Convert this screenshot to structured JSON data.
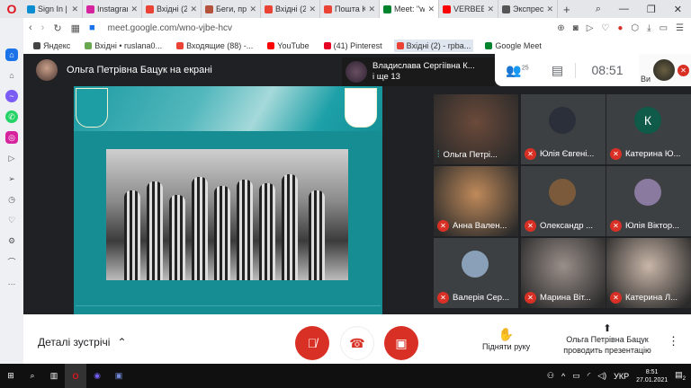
{
  "browser": {
    "tabs": [
      {
        "label": "Sign In |",
        "color": "#0b8ed1"
      },
      {
        "label": "Instagram",
        "color": "#d6249f"
      },
      {
        "label": "Вхідні (2",
        "color": "#ea4335"
      },
      {
        "label": "Беги, пр",
        "color": "#b5523b"
      },
      {
        "label": "Вхідні (2",
        "color": "#ea4335"
      },
      {
        "label": "Пошта К",
        "color": "#ea4335"
      },
      {
        "label": "Meet: \"w",
        "color": "#00832d"
      },
      {
        "label": "VERBEE",
        "color": "#ff0000"
      },
      {
        "label": "Экспрес",
        "color": "#555555"
      }
    ],
    "new_tab": "+",
    "url": "meet.google.com/wno-vjbe-hcv",
    "bookmarks": [
      {
        "label": "Яндекс",
        "color": "#444444"
      },
      {
        "label": "Вхідні • ruslana0...",
        "color": "#6aa84f"
      },
      {
        "label": "Входящие (88) -...",
        "color": "#ea4335"
      },
      {
        "label": "YouTube",
        "color": "#ff0000"
      },
      {
        "label": "(41) Pinterest",
        "color": "#e60023"
      },
      {
        "label": "Вхідні (2) - rpba...",
        "color": "#ea4335"
      },
      {
        "label": "Google Meet",
        "color": "#00832d"
      }
    ]
  },
  "meet": {
    "presenter_title": "Ольга Петрівна Бацук на екрані",
    "pinned": {
      "name": "Владислава Сергіївна К...",
      "more": "і ще 13"
    },
    "participants_count": "25",
    "time": "08:51",
    "self_label": "Ви",
    "tiles": [
      {
        "name": "Ольга Петрі...",
        "type": "video",
        "color": "#6b4a3a",
        "speaking": true
      },
      {
        "name": "Юлія Євгені...",
        "type": "avatar",
        "color": "#2a2f3a",
        "letter": ""
      },
      {
        "name": "Катерина Ю...",
        "type": "avatar",
        "color": "#0f5a48",
        "letter": "К"
      },
      {
        "name": "Анна Вален...",
        "type": "video",
        "color": "#c08a5a"
      },
      {
        "name": "Олександр ...",
        "type": "avatar",
        "color": "#7a5a3a",
        "letter": ""
      },
      {
        "name": "Юлія Віктор...",
        "type": "avatar",
        "color": "#8a7aa0",
        "letter": ""
      },
      {
        "name": "Валерія Сер...",
        "type": "avatar",
        "color": "#8aa0b8",
        "letter": ""
      },
      {
        "name": "Марина Віт...",
        "type": "video",
        "color": "#9a8f8a"
      },
      {
        "name": "Катерина Л...",
        "type": "video",
        "color": "#c9b6a8"
      }
    ],
    "details": "Деталі зустрічі",
    "raise_hand": "Підняти руку",
    "presenting": "Ольга Петрівна Бацук проводить презентацію"
  },
  "taskbar": {
    "lang": "УКР",
    "time": "8:51",
    "date": "27.01.2021",
    "notif": "2"
  }
}
